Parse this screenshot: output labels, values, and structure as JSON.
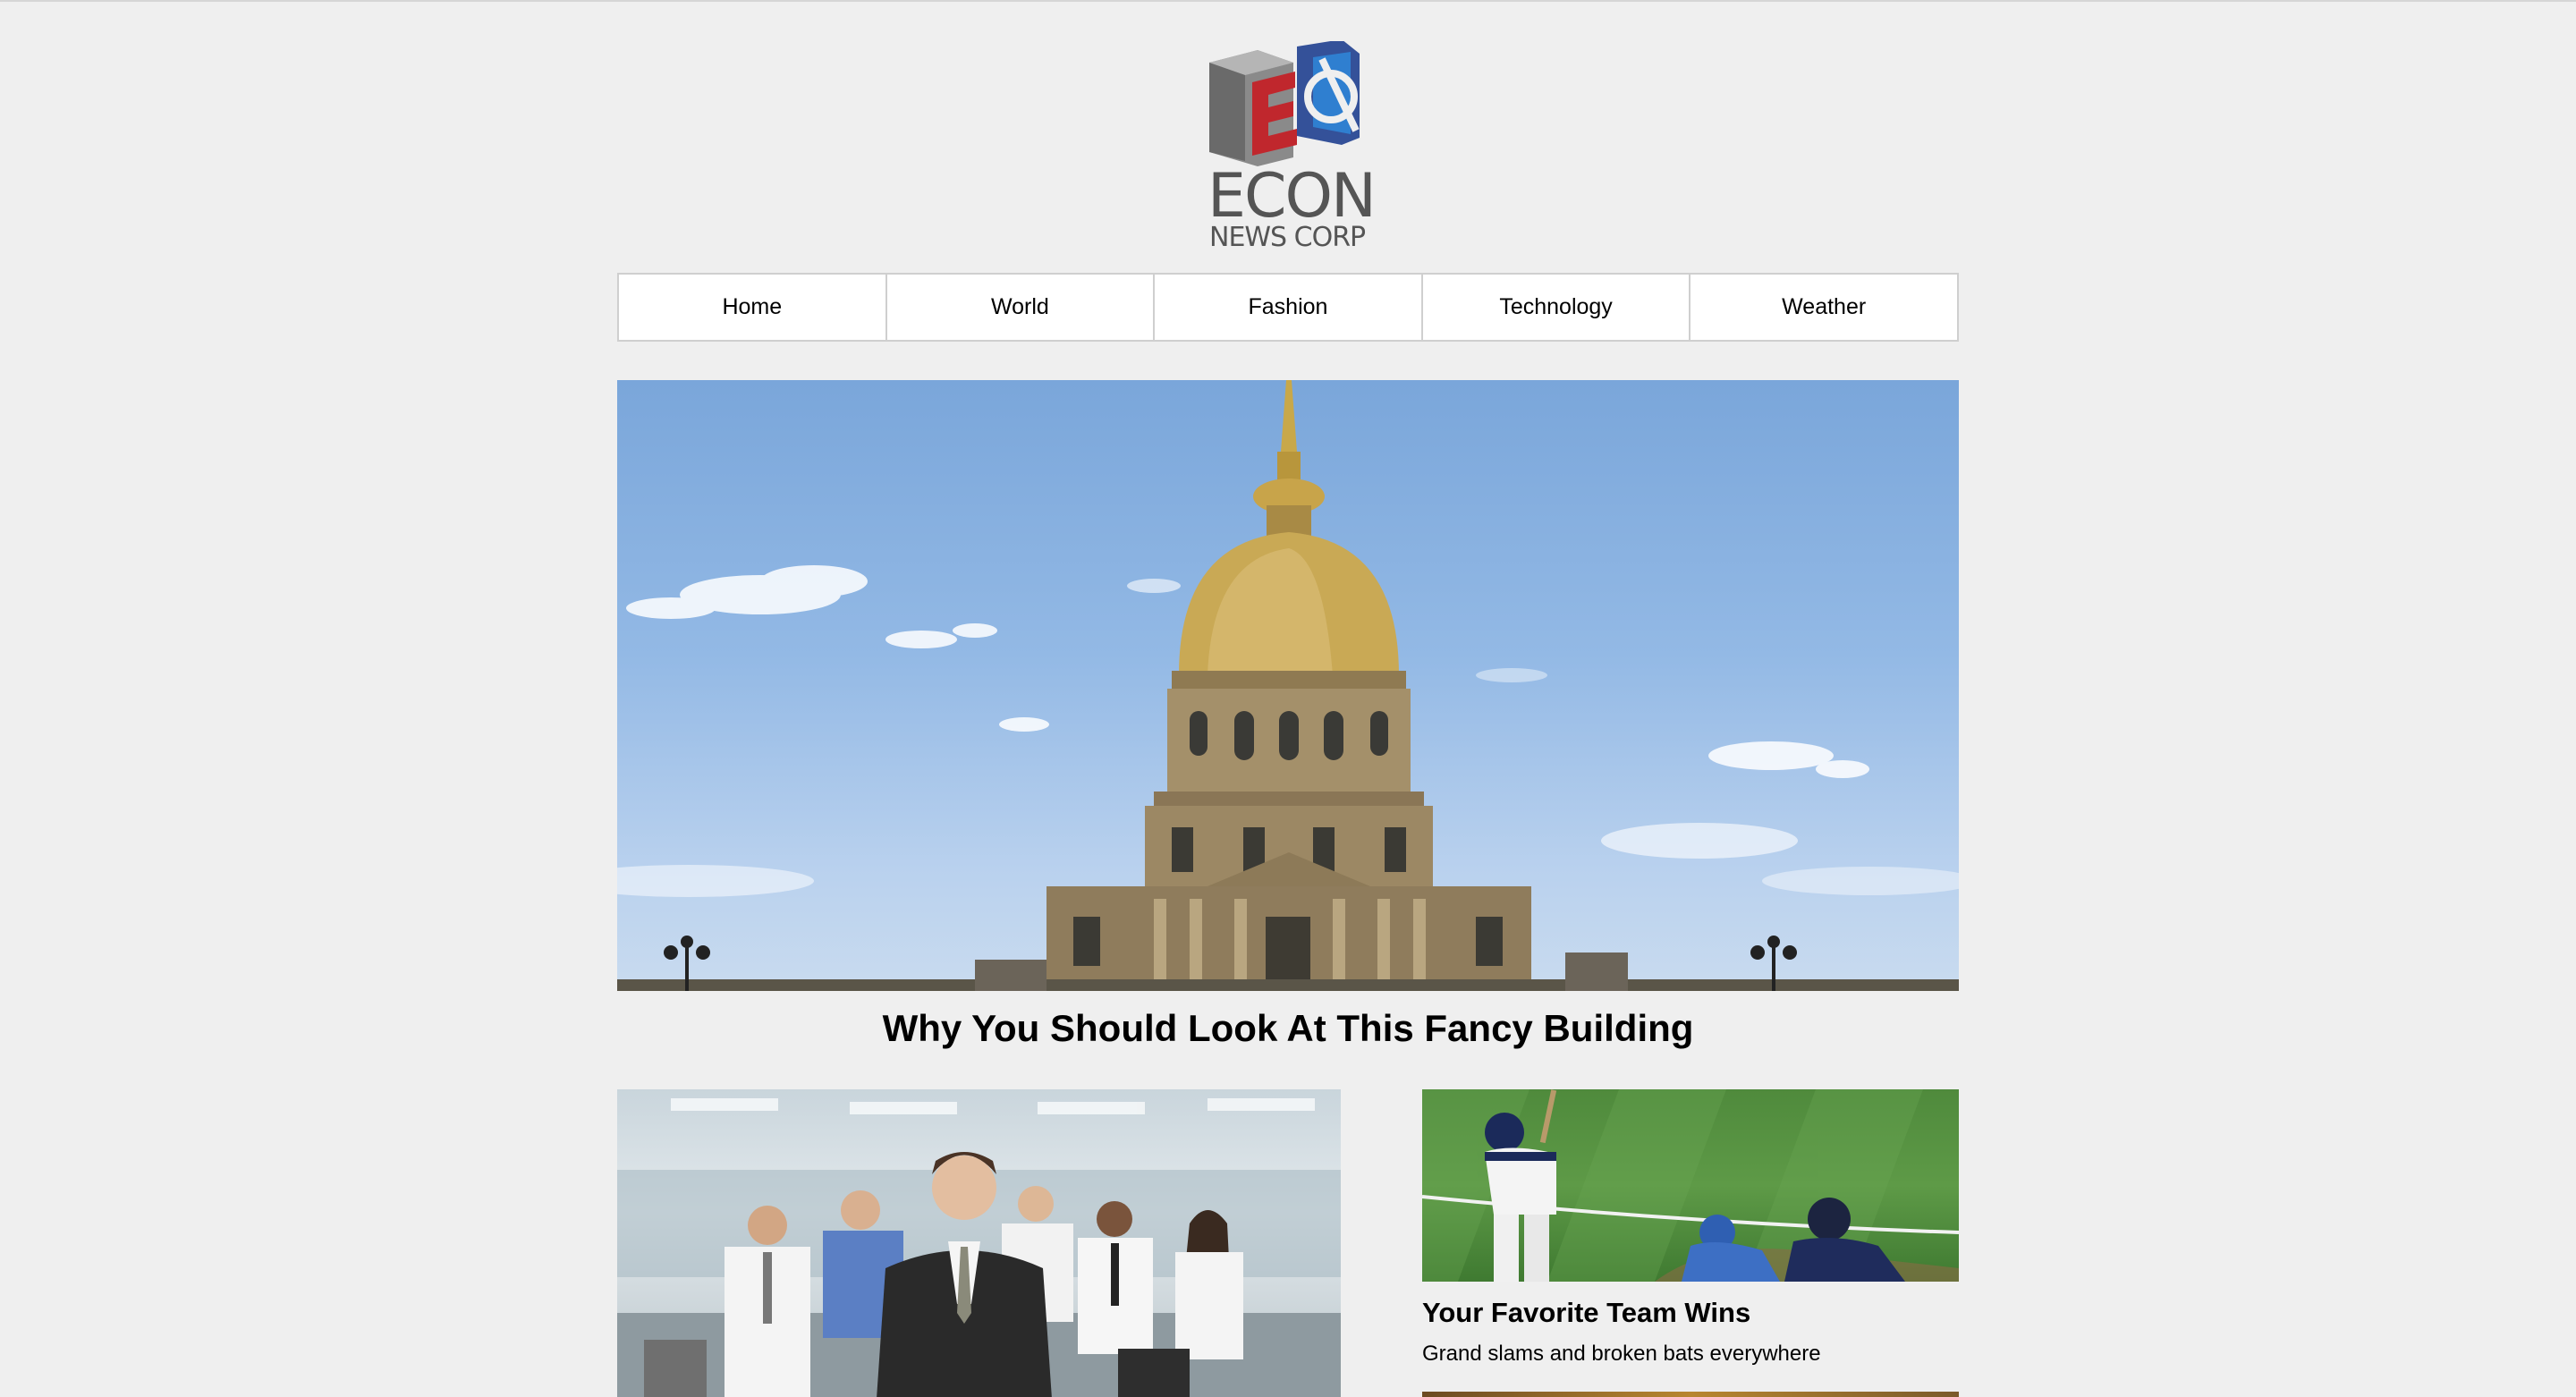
{
  "brand": {
    "logo_word": "ECON",
    "logo_sub": "NEWS CORP",
    "colors": {
      "red": "#c0272d",
      "blue": "#1f6fb5",
      "gray": "#555555"
    }
  },
  "nav": {
    "items": [
      {
        "label": "Home"
      },
      {
        "label": "World"
      },
      {
        "label": "Fashion"
      },
      {
        "label": "Technology"
      },
      {
        "label": "Weather"
      }
    ]
  },
  "hero": {
    "title": "Why You Should Look At This Fancy Building"
  },
  "stories": [
    {
      "title": "Your Favorite Team Wins",
      "subtitle": "Grand slams and broken bats everywhere"
    }
  ]
}
